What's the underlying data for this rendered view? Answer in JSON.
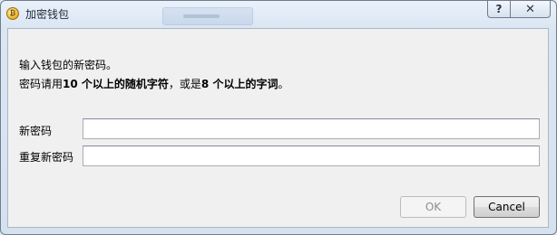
{
  "window": {
    "title": "加密钱包",
    "help_label": "?",
    "close_label": "✕"
  },
  "message": {
    "line1": "输入钱包的新密码。",
    "line2_prefix": "密码请用",
    "line2_bold1": "10 个以上的随机字符",
    "line2_mid": "，或是",
    "line2_bold2": "8 个以上的字词",
    "line2_suffix": "。"
  },
  "form": {
    "new_password_label": "新密码",
    "new_password_value": "",
    "repeat_password_label": "重复新密码",
    "repeat_password_value": ""
  },
  "buttons": {
    "ok_label": "OK",
    "ok_enabled": false,
    "cancel_label": "Cancel"
  },
  "icons": {
    "app": "bitcoin-icon",
    "help": "help-icon",
    "close": "close-icon"
  }
}
